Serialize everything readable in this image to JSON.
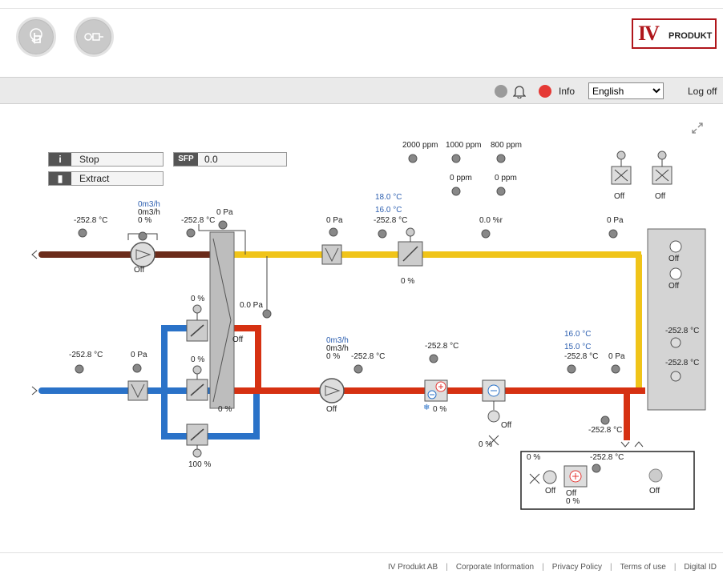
{
  "header": {
    "touch_button": "touch-icon",
    "flow_button": "flow-icon",
    "logo": {
      "mark": "IV",
      "text": "PRODUKT"
    }
  },
  "menubar": {
    "info_label": "Info",
    "language": "English",
    "language_options": [
      "English"
    ],
    "logoff_label": "Log off",
    "status_colors": {
      "gray": "#9a9a9a",
      "red": "#e53935"
    }
  },
  "status": {
    "mode_label": "Stop",
    "type_label": "Extract",
    "sfp_label": "SFP",
    "sfp_value": "0.0"
  },
  "co2": {
    "row1": [
      "2000 ppm",
      "1000 ppm",
      "800 ppm"
    ],
    "row2": [
      "0 ppm",
      "0 ppm"
    ]
  },
  "fans_top": {
    "left": "Off",
    "right": "Off"
  },
  "extract_line": {
    "temp_left": "-252.8 °C",
    "fan_flow_blue": "0m3/h",
    "fan_flow": "0m3/h",
    "fan_pct": "0 %",
    "fan_state": "Off",
    "temp_mid": "-252.8 °C",
    "hx_pressure": "0 Pa",
    "filter_pressure": "0 Pa",
    "setpoint_blue": "18.0 °C",
    "setpoint_red": "16.0 °C",
    "temp_right": "-252.8 °C",
    "damper_pct": "0 %",
    "humidity": "0.0 %r",
    "pressure_right": "0 Pa"
  },
  "unit_right": {
    "timer1": "Off",
    "timer2": "Off",
    "temp1": "-252.8 °C",
    "temp2": "-252.8 °C"
  },
  "bypass": {
    "top_pct": "0 %",
    "mid_pct": "0 %",
    "bottom_pct": "100 %",
    "pressure": "0.0 Pa",
    "hx_state": "Off",
    "hx_pct": "0 %"
  },
  "supply_line": {
    "temp_left": "-252.8 °C",
    "filter_pressure": "0 Pa",
    "fan_flow_blue": "0m3/h",
    "fan_flow": "0m3/h",
    "fan_pct": "0 %",
    "fan_state": "Off",
    "temp_after_fan": "-252.8 °C",
    "heater_temp": "-252.8 °C",
    "heater_pct": "0 %",
    "cooler_state": "Off",
    "cooler_pct": "0 %",
    "setpoint_blue": "16.0 °C",
    "setpoint_red": "15.0 °C",
    "temp_right": "-252.8 °C",
    "pressure_right": "0 Pa",
    "temp_bottom": "-252.8 °C"
  },
  "reheat_box": {
    "valve_pct": "0 %",
    "pump_state": "Off",
    "heater_state": "Off",
    "heater_pct": "0 %",
    "temp": "-252.8 °C",
    "speaker_state": "Off"
  },
  "footer": {
    "company": "IV Produkt AB",
    "corporate": "Corporate Information",
    "privacy": "Privacy Policy",
    "terms": "Terms of use",
    "digital": "Digital ID"
  },
  "colors": {
    "extract_duct": "#6b2b1a",
    "supply_cold": "#2a72c8",
    "supply_hot": "#d63112",
    "exhaust": "#f0c419"
  }
}
